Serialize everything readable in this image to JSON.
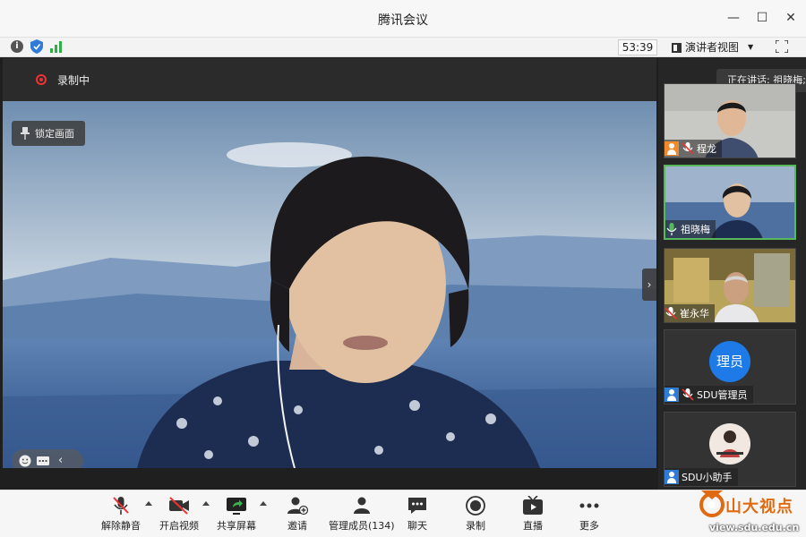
{
  "window": {
    "title": "腾讯会议"
  },
  "infobar": {
    "timer": "53:39",
    "view_mode": "演讲者视图"
  },
  "main": {
    "recording_label": "录制中",
    "lock_view_label": "锁定画面"
  },
  "sidebar": {
    "speaking_tip": "正在讲话: 祖晓梅;",
    "participants": [
      {
        "name": "程龙"
      },
      {
        "name": "祖晓梅"
      },
      {
        "name": "崔永华"
      },
      {
        "name": "SDU管理员",
        "avatar_text": "理员"
      },
      {
        "name": "SDU小助手"
      }
    ]
  },
  "toolbar": {
    "items": [
      {
        "label": "解除静音",
        "icon": "muted-mic-icon"
      },
      {
        "label": "开启视频",
        "icon": "video-off-icon"
      },
      {
        "label": "共享屏幕",
        "icon": "share-screen-icon"
      },
      {
        "label": "邀请",
        "icon": "invite-icon"
      },
      {
        "label": "管理成员(134)",
        "icon": "members-icon"
      },
      {
        "label": "聊天",
        "icon": "chat-icon"
      },
      {
        "label": "录制",
        "icon": "record-icon"
      },
      {
        "label": "直播",
        "icon": "live-icon"
      },
      {
        "label": "更多",
        "icon": "more-icon"
      }
    ]
  },
  "watermark": {
    "text": "山大视点",
    "url": "view.sdu.edu.cn"
  },
  "colors": {
    "recording": "#e33333",
    "active_speaker": "#57b95c",
    "accent": "#1e7ae6"
  }
}
